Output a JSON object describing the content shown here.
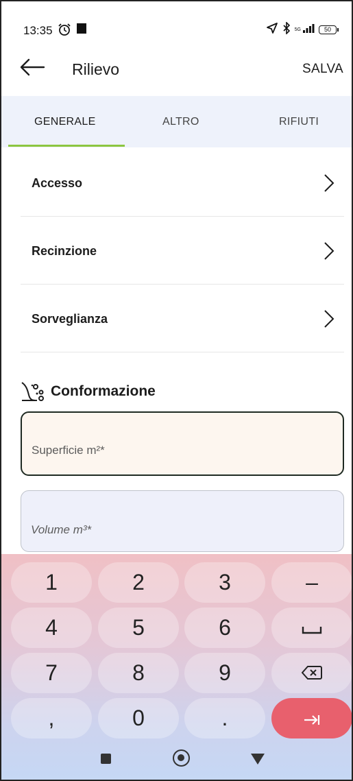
{
  "status_bar": {
    "time": "13:35",
    "network": "5G",
    "battery": "50"
  },
  "app_bar": {
    "title": "Rilievo",
    "save_label": "SALVA"
  },
  "tabs": [
    {
      "label": "GENERALE",
      "active": true
    },
    {
      "label": "ALTRO",
      "active": false
    },
    {
      "label": "RIFIUTI",
      "active": false
    }
  ],
  "list_items": [
    {
      "label": "Accesso"
    },
    {
      "label": "Recinzione"
    },
    {
      "label": "Sorveglianza"
    }
  ],
  "section": {
    "title": "Conformazione",
    "icon": "landslide-icon"
  },
  "fields": {
    "surface_placeholder": "Superficie m²*",
    "volume_placeholder": "Volume m³*"
  },
  "keyboard": {
    "keys": [
      "1",
      "2",
      "3",
      "–",
      "4",
      "5",
      "6",
      "␣",
      "7",
      "8",
      "9",
      "backspace",
      ",",
      "0",
      ".",
      "next"
    ]
  },
  "colors": {
    "accent": "#8cc63f",
    "enter_key": "#e8606d",
    "tab_bg": "#eef2fb"
  }
}
